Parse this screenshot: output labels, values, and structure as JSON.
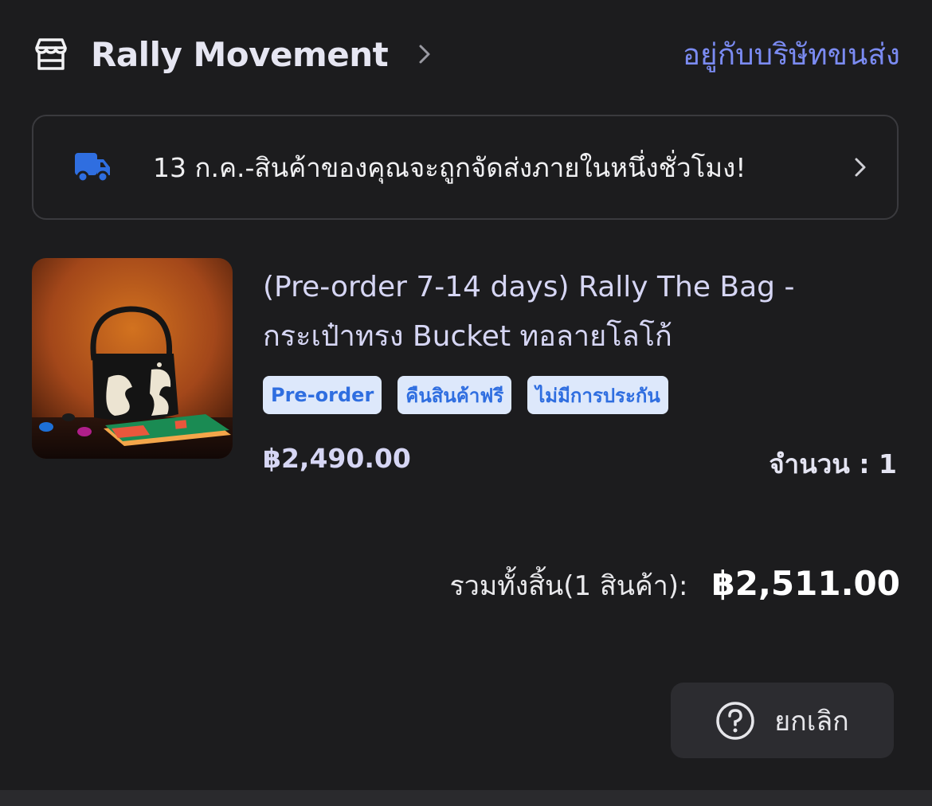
{
  "shop": {
    "name": "Rally Movement",
    "shipping_status": "อยู่กับบริษัทขนส่ง"
  },
  "delivery": {
    "message": "13 ก.ค.-สินค้าของคุณจะถูกจัดส่งภายในหนึ่งชั่วโมง!"
  },
  "product": {
    "title_line1": "(Pre-order 7-14 days) Rally The Bag -",
    "title_line2": "กระเป๋าทรง Bucket ทอลายโลโก้",
    "tags": [
      "Pre-order",
      "คืนสินค้าฟรี",
      "ไม่มีการประกัน"
    ],
    "price": "฿2,490.00",
    "quantity": "จำนวน : 1"
  },
  "summary": {
    "total_label": "รวมทั้งสิ้น(1 สินค้า):",
    "total_value": "฿2,511.00"
  },
  "actions": {
    "cancel_label": "ยกเลิก"
  },
  "colors": {
    "background": "#1c1c1e",
    "accent_link": "#7b8bf2",
    "truck": "#2f6ee0",
    "tag_bg": "#dde8fb",
    "tag_text": "#2f6ee0"
  },
  "icons": {
    "store": "store-icon",
    "chevron": "chevron-right-icon",
    "truck": "truck-icon",
    "help": "help-circle-icon"
  }
}
